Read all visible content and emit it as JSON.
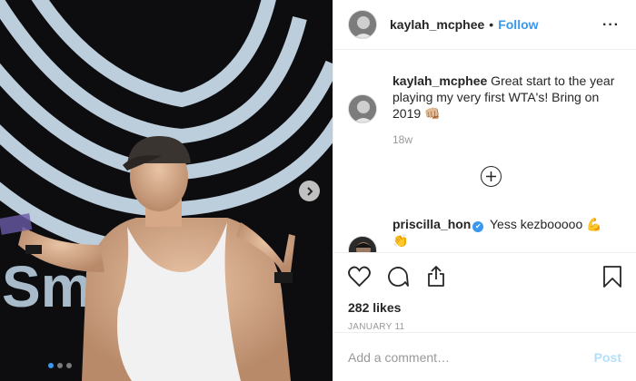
{
  "post": {
    "author": "kaylah_mcphee",
    "separator": "•",
    "follow_label": "Follow",
    "more_label": "···"
  },
  "photo": {
    "background_text": "Sma",
    "carousel_dots": 3,
    "active_dot": 0
  },
  "caption": {
    "username": "kaylah_mcphee",
    "text": " Great start to the year playing my very first WTA's! Bring on 2019 👊🏼",
    "time": "18w"
  },
  "comments": [
    {
      "username": "priscilla_hon",
      "verified": true,
      "text": " Yess kezbooooo 💪👏"
    }
  ],
  "likes": "282 likes",
  "date": "JANUARY 11",
  "add_comment": {
    "placeholder": "Add a comment…",
    "post_label": "Post"
  },
  "colors": {
    "accent": "#3897f0",
    "post_disabled": "#b2dffc",
    "muted": "#999999"
  },
  "icons": [
    "chevron-right-icon",
    "more-icon",
    "plus-circle-icon",
    "heart-icon",
    "comment-icon",
    "share-icon",
    "bookmark-icon",
    "verified-icon"
  ]
}
